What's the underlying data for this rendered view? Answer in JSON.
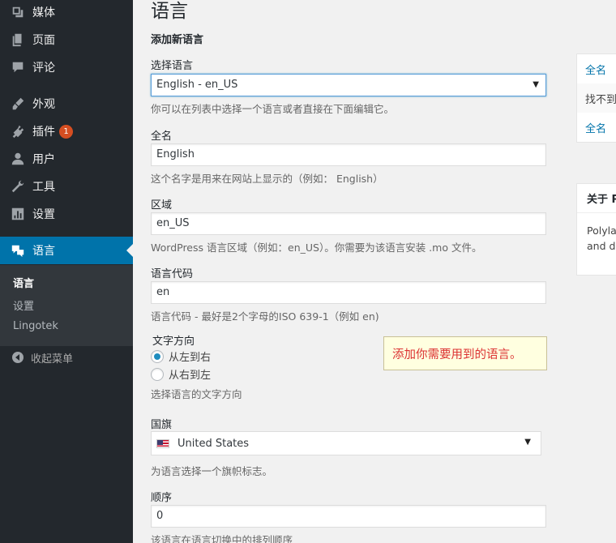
{
  "sidebar": {
    "items": [
      {
        "label": "媒体",
        "icon": "media-icon"
      },
      {
        "label": "页面",
        "icon": "pages-icon"
      },
      {
        "label": "评论",
        "icon": "comments-icon"
      },
      {
        "label": "外观",
        "icon": "appearance-icon"
      },
      {
        "label": "插件",
        "icon": "plugins-icon",
        "badge": "1"
      },
      {
        "label": "用户",
        "icon": "users-icon"
      },
      {
        "label": "工具",
        "icon": "tools-icon"
      },
      {
        "label": "设置",
        "icon": "settings-icon"
      },
      {
        "label": "语言",
        "icon": "language-icon",
        "active": true
      }
    ],
    "submenu": [
      "语言",
      "设置",
      "Lingotek"
    ],
    "collapse_label": "收起菜单",
    "active_color": "#0073aa",
    "bg_color": "#23282d"
  },
  "main": {
    "page_title": "语言",
    "section_title": "添加新语言",
    "choose_language": {
      "label": "选择语言",
      "value": "English - en_US",
      "desc": "你可以在列表中选择一个语言或者直接在下面编辑它。"
    },
    "full_name": {
      "label": "全名",
      "value": "English",
      "desc": "这个名字是用来在网站上显示的（例如： English）"
    },
    "locale": {
      "label": "区域",
      "value": "en_US",
      "desc": "WordPress 语言区域（例如：en_US）。你需要为该语言安装 .mo 文件。"
    },
    "code": {
      "label": "语言代码",
      "value": "en",
      "desc": "语言代码 - 最好是2个字母的ISO 639-1（例如 en)"
    },
    "direction": {
      "label": "文字方向",
      "ltr": "从左到右",
      "rtl": "从右到左",
      "selected": "ltr",
      "desc": "选择语言的文字方向"
    },
    "flag": {
      "label": "国旗",
      "value": "United States",
      "desc": "为语言选择一个旗帜标志。"
    },
    "order": {
      "label": "顺序",
      "value": "0",
      "desc": "该语言在语言切换中的排列顺序"
    },
    "tooltip": "添加你需要用到的语言。"
  },
  "right": {
    "table": [
      "全名",
      "找不到",
      "全名"
    ],
    "about_title": "关于 P",
    "about_line1": "Polylar",
    "about_line2": "and do"
  }
}
